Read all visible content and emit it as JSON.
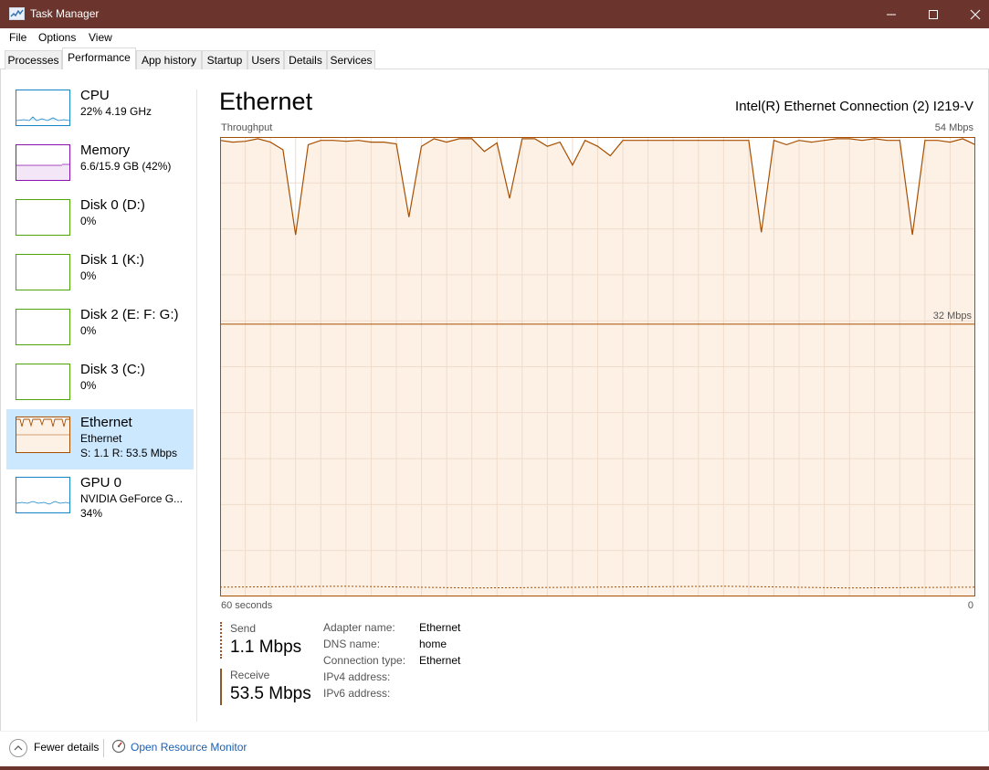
{
  "window": {
    "title": "Task Manager"
  },
  "menu": [
    "File",
    "Options",
    "View"
  ],
  "tabs": [
    "Processes",
    "Performance",
    "App history",
    "Startup",
    "Users",
    "Details",
    "Services"
  ],
  "sidebar": {
    "items": [
      {
        "name": "CPU",
        "sub1": "22%  4.19 GHz",
        "sub2": "",
        "color": "#1784c9"
      },
      {
        "name": "Memory",
        "sub1": "6.6/15.9 GB (42%)",
        "sub2": "",
        "color": "#8b12ae"
      },
      {
        "name": "Disk 0 (D:)",
        "sub1": "0%",
        "sub2": "",
        "color": "#4da60c"
      },
      {
        "name": "Disk 1 (K:)",
        "sub1": "0%",
        "sub2": "",
        "color": "#4da60c"
      },
      {
        "name": "Disk 2 (E: F: G:)",
        "sub1": "0%",
        "sub2": "",
        "color": "#4da60c"
      },
      {
        "name": "Disk 3 (C:)",
        "sub1": "0%",
        "sub2": "",
        "color": "#4da60c"
      },
      {
        "name": "Ethernet",
        "sub1": "Ethernet",
        "sub2": "S: 1.1  R: 53.5 Mbps",
        "color": "#a74f01"
      },
      {
        "name": "GPU 0",
        "sub1": "NVIDIA GeForce G...",
        "sub2": "34%",
        "color": "#1784c9"
      }
    ]
  },
  "detail": {
    "title": "Ethernet",
    "adapter": "Intel(R) Ethernet Connection (2) I219-V",
    "throughput_label": "Throughput",
    "max_label": "54 Mbps",
    "mid_label": "32 Mbps",
    "x_left": "60 seconds",
    "x_right": "0",
    "send_label": "Send",
    "send_value": "1.1 Mbps",
    "receive_label": "Receive",
    "receive_value": "53.5 Mbps",
    "properties": [
      {
        "key": "Adapter name:",
        "value": "Ethernet"
      },
      {
        "key": "DNS name:",
        "value": "home"
      },
      {
        "key": "Connection type:",
        "value": "Ethernet"
      },
      {
        "key": "IPv4 address:",
        "value": ""
      },
      {
        "key": "IPv6 address:",
        "value": ""
      }
    ]
  },
  "footer": {
    "fewer_details": "Fewer details",
    "open_rm": "Open Resource Monitor"
  },
  "colors": {
    "titlebar": "#6b352d",
    "ethernet": "#a74f01",
    "graph_fill": "#fdf1e6",
    "selected": "#cce8ff"
  },
  "chart_data": {
    "type": "line",
    "title": "Throughput",
    "xlabel": "",
    "ylabel": "",
    "xlim": [
      60,
      0
    ],
    "ylim": [
      0,
      54
    ],
    "grid": true,
    "series": [
      {
        "name": "Receive",
        "x": [
          60,
          59,
          58,
          57,
          56,
          55,
          54,
          53,
          52,
          51,
          50,
          49,
          48,
          47,
          46,
          45,
          44,
          43,
          42,
          41,
          40,
          39,
          38,
          37,
          36,
          35,
          34,
          33,
          32,
          31,
          30,
          29,
          28,
          27,
          26,
          25,
          24,
          23,
          22,
          21,
          20,
          19,
          18,
          17,
          16,
          15,
          14,
          13,
          12,
          11,
          10,
          9,
          8,
          7,
          6,
          5,
          4,
          3,
          2,
          1,
          0
        ],
        "values": [
          53.6,
          53.4,
          53.5,
          53.8,
          53.4,
          52.5,
          42.5,
          53.1,
          53.6,
          53.6,
          53.5,
          53.6,
          53.4,
          53.4,
          53.2,
          44.6,
          52.9,
          53.8,
          53.4,
          53.8,
          53.8,
          52.3,
          53.3,
          46.8,
          53.8,
          53.8,
          52.9,
          53.4,
          50.7,
          53.6,
          52.9,
          51.8,
          53.6,
          53.6,
          53.6,
          53.6,
          53.6,
          53.6,
          53.6,
          53.6,
          53.6,
          53.6,
          53.6,
          42.8,
          53.6,
          53.1,
          53.6,
          53.4,
          53.6,
          53.8,
          53.8,
          53.6,
          53.8,
          53.6,
          53.6,
          42.5,
          53.6,
          53.6,
          53.4,
          53.8,
          53.1
        ]
      },
      {
        "name": "Send",
        "x": [
          60,
          50,
          40,
          30,
          20,
          10,
          0
        ],
        "values": [
          1.1,
          1.2,
          1.0,
          1.1,
          1.2,
          1.0,
          1.1
        ]
      }
    ]
  }
}
